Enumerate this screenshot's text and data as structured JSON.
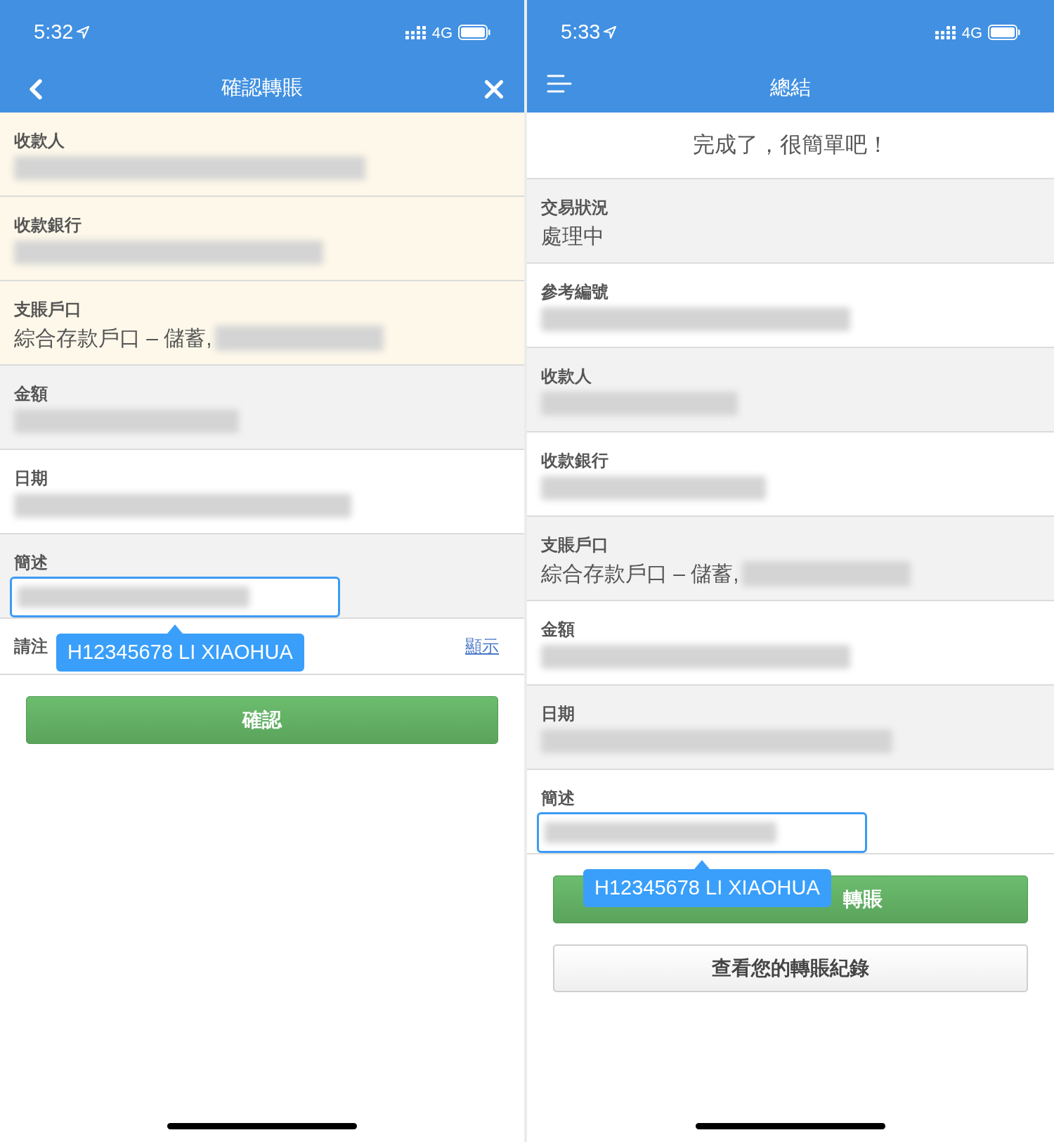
{
  "phones": [
    {
      "status_bar": {
        "time": "5:32",
        "network": "4G"
      },
      "nav": {
        "title": "確認轉賬",
        "back_button": true,
        "menu_button": false,
        "close_button": true
      },
      "rows": [
        {
          "label": "收款人",
          "kind": "redacted",
          "highlighted": true,
          "shaded": false
        },
        {
          "label": "收款銀行",
          "kind": "redacted",
          "highlighted": true,
          "shaded": false
        },
        {
          "label": "支賬戶口",
          "kind": "partial",
          "value": "綜合存款戶口 – 儲蓄,",
          "highlighted": true,
          "shaded": false
        },
        {
          "label": "金額",
          "kind": "redacted",
          "highlighted": false,
          "shaded": true
        },
        {
          "label": "日期",
          "kind": "redacted",
          "highlighted": false,
          "shaded": false
        },
        {
          "label": "簡述",
          "kind": "input",
          "highlighted": false,
          "shaded": true,
          "tooltip": "H12345678 LI XIAOHUA"
        }
      ],
      "notice": {
        "text": "請注",
        "link": "顯示"
      },
      "buttons": [
        {
          "label": "確認",
          "kind": "primary"
        }
      ]
    },
    {
      "status_bar": {
        "time": "5:33",
        "network": "4G"
      },
      "nav": {
        "title": "總結",
        "back_button": false,
        "menu_button": true,
        "close_button": false
      },
      "banner": "完成了，很簡單吧！",
      "rows": [
        {
          "label": "交易狀況",
          "kind": "text",
          "value": "處理中",
          "highlighted": false,
          "shaded": true
        },
        {
          "label": "參考編號",
          "kind": "redacted",
          "highlighted": false,
          "shaded": false
        },
        {
          "label": "收款人",
          "kind": "redacted",
          "highlighted": false,
          "shaded": true
        },
        {
          "label": "收款銀行",
          "kind": "redacted",
          "highlighted": false,
          "shaded": false
        },
        {
          "label": "支賬戶口",
          "kind": "partial",
          "value": "綜合存款戶口 – 儲蓄,",
          "highlighted": false,
          "shaded": true
        },
        {
          "label": "金額",
          "kind": "redacted",
          "highlighted": false,
          "shaded": false
        },
        {
          "label": "日期",
          "kind": "redacted",
          "highlighted": false,
          "shaded": true
        },
        {
          "label": "簡述",
          "kind": "input",
          "highlighted": false,
          "shaded": false,
          "tooltip": "H12345678 LI XIAOHUA"
        }
      ],
      "buttons": [
        {
          "label": "轉賬",
          "kind": "primary_covered"
        },
        {
          "label": "查看您的轉賬紀錄",
          "kind": "secondary"
        }
      ]
    }
  ]
}
